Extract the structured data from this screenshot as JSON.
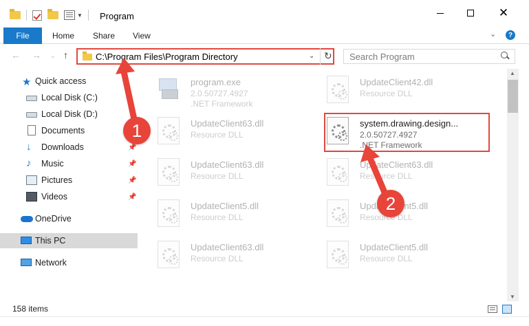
{
  "window": {
    "title": "Program"
  },
  "ribbon": {
    "tabs": [
      "File",
      "Home",
      "Share",
      "View"
    ]
  },
  "address": {
    "path": "C:\\Program Files\\Program Directory",
    "search_placeholder": "Search Program"
  },
  "sidebar": {
    "items": [
      {
        "label": "Quick access",
        "icon": "star-icon",
        "pinned": false
      },
      {
        "label": "Local Disk (C:)",
        "icon": "disk-icon",
        "pinned": true
      },
      {
        "label": "Local Disk (D:)",
        "icon": "disk-icon",
        "pinned": false
      },
      {
        "label": "Documents",
        "icon": "documents-icon",
        "pinned": true
      },
      {
        "label": "Downloads",
        "icon": "downloads-icon",
        "pinned": true
      },
      {
        "label": "Music",
        "icon": "music-icon",
        "pinned": true
      },
      {
        "label": "Pictures",
        "icon": "pictures-icon",
        "pinned": true
      },
      {
        "label": "Videos",
        "icon": "videos-icon",
        "pinned": true
      },
      {
        "label": "OneDrive",
        "icon": "cloud-icon",
        "pinned": false
      },
      {
        "label": "This PC",
        "icon": "computer-icon",
        "pinned": false,
        "selected": true
      },
      {
        "label": "Network",
        "icon": "network-icon",
        "pinned": false
      }
    ]
  },
  "files": [
    {
      "name": "program.exe",
      "line1": "2.0.50727.4927",
      "line2": ".NET Framework",
      "icon": "exe-icon"
    },
    {
      "name": "UpdateClient42.dll",
      "line1": "Resource DLL",
      "line2": "",
      "icon": "dll-icon"
    },
    {
      "name": "UpdateClient63.dll",
      "line1": "Resource DLL",
      "line2": "",
      "icon": "dll-icon"
    },
    {
      "name": "system.drawing.design...",
      "line1": "2.0.50727.4927",
      "line2": ".NET Framework",
      "icon": "dll-icon",
      "highlighted": true
    },
    {
      "name": "UpdateClient63.dll",
      "line1": "Resource DLL",
      "line2": "",
      "icon": "dll-icon"
    },
    {
      "name": "UpdateClient63.dll",
      "line1": "Resource DLL",
      "line2": "",
      "icon": "dll-icon"
    },
    {
      "name": "UpdateClient5.dll",
      "line1": "Resource DLL",
      "line2": "",
      "icon": "dll-icon"
    },
    {
      "name": "UpdateClient5.dll",
      "line1": "Resource DLL",
      "line2": "",
      "icon": "dll-icon"
    },
    {
      "name": "UpdateClient63.dll",
      "line1": "Resource DLL",
      "line2": "",
      "icon": "dll-icon"
    },
    {
      "name": "UpdateClient5.dll",
      "line1": "Resource DLL",
      "line2": "",
      "icon": "dll-icon"
    }
  ],
  "status": {
    "item_count": "158 items"
  },
  "annotations": [
    {
      "label": "1"
    },
    {
      "label": "2"
    }
  ],
  "colors": {
    "accent": "#1979ca",
    "annotation_red": "#e1473f"
  }
}
